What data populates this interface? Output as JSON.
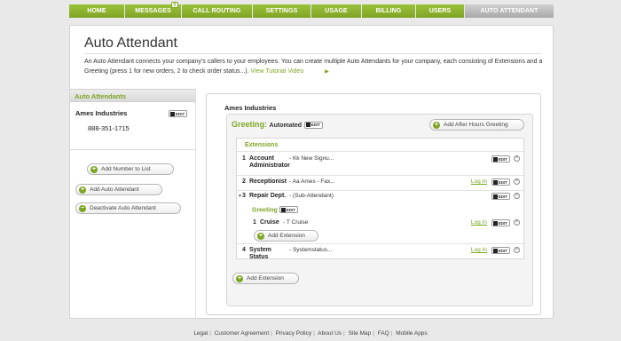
{
  "nav": {
    "items": [
      {
        "label": "HOME"
      },
      {
        "label": "MESSAGES",
        "badge": "0"
      },
      {
        "label": "CALL ROUTING"
      },
      {
        "label": "SETTINGS"
      },
      {
        "label": "USAGE"
      },
      {
        "label": "BILLING"
      },
      {
        "label": "USERS"
      },
      {
        "label": "AUTO ATTENDANT",
        "active": true
      }
    ]
  },
  "page": {
    "title": "Auto Attendant",
    "intro": "An Auto Attendant connects your company's callers to your employees. You can create multiple Auto Attendants for your company, each consisting of Extensions and a Greeting (press 1 for new orders, 2 to check order status...).",
    "tutorial_link": "View Tutorial Video"
  },
  "sidebar": {
    "heading": "Auto Attendants",
    "company": "Ames Industries",
    "edit_label": "EDIT",
    "phone": "888-351-1715",
    "add_number": "Add Number to List",
    "add_attendant": "Add Auto Attendant",
    "deactivate": "Deactivate Auto Attendant"
  },
  "detail": {
    "company": "Ames Industries",
    "greeting_label": "Greeting:",
    "greeting_value": "Automated",
    "edit_label": "EDIT",
    "after_hours": "Add After Hours Greeting",
    "extensions_heading": "Extensions",
    "rows": [
      {
        "num": "1",
        "name": "Account Administrator",
        "desc": "- Kk New Signu...",
        "login": ""
      },
      {
        "num": "2",
        "name": "Receptionist",
        "desc": "- Aa Ames - Fax...",
        "login": "Log In"
      },
      {
        "num": "3",
        "name": "Repair Dept.",
        "desc": "- (Sub-Attendant)",
        "login": ""
      },
      {
        "num": "4",
        "name": "System Status",
        "desc": "- Systemstatus...",
        "login": "Log In"
      }
    ],
    "sub": {
      "greeting_label": "Greeting",
      "row": {
        "num": "1",
        "name": "Cruise",
        "desc": "- T Cruise",
        "login": "Log In"
      },
      "add_extension": "Add Extension"
    },
    "add_extension": "Add Extension"
  },
  "footer": {
    "links": [
      "Legal",
      "Customer Agreement",
      "Privacy Policy",
      "About Us",
      "Site Map",
      "FAQ",
      "Mobile Apps"
    ]
  }
}
